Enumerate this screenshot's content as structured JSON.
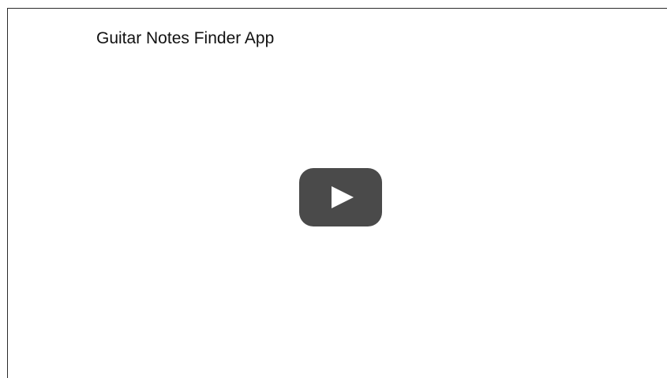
{
  "video": {
    "title": "Guitar Notes Finder App",
    "play_icon": "play-icon",
    "play_button_color": "#4a4a4a"
  }
}
